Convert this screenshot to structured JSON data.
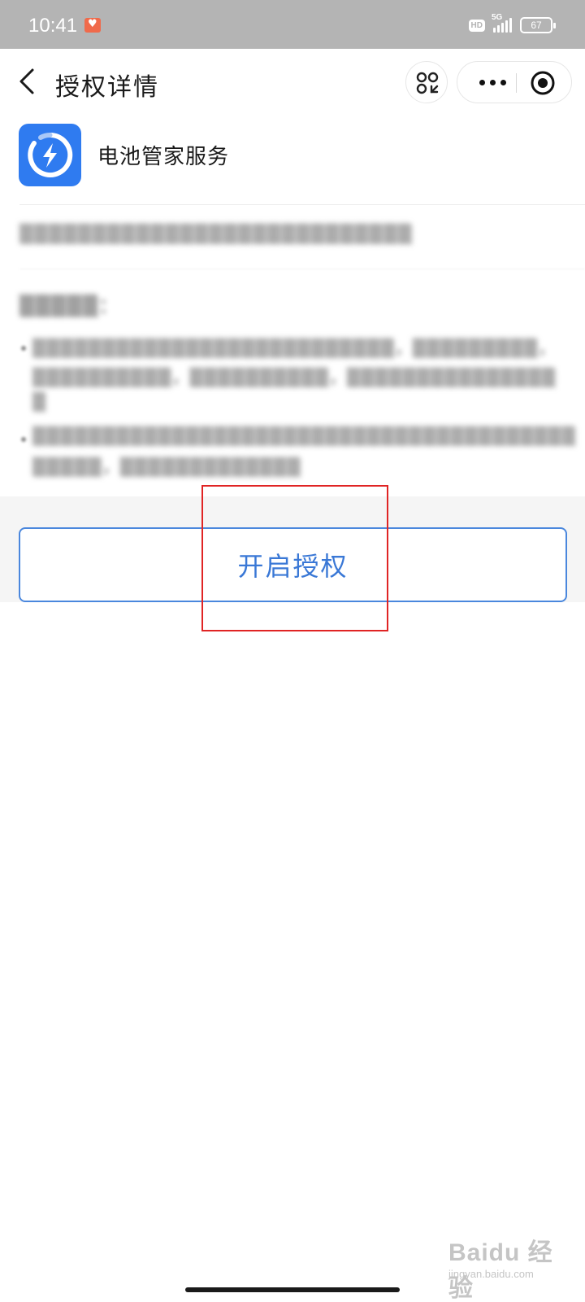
{
  "status_bar": {
    "time": "10:41",
    "hd": "HD",
    "network": "5G",
    "battery": "67"
  },
  "nav": {
    "title": "授权详情"
  },
  "app": {
    "name": "电池管家服务",
    "logo_color": "#2f7bf0"
  },
  "blurred": {
    "subtitle": "▒▒▒▒▒▒▒▒▒▒▒▒▒▒▒▒▒▒▒▒▒▒▒▒▒▒▒",
    "section_heading": "▒▒▒▒▒：",
    "bullet1_line1": "▒▒▒▒▒▒▒▒▒▒▒▒▒▒▒▒▒▒▒▒▒▒▒▒▒▒，▒▒▒▒▒▒▒▒▒，",
    "bullet1_line2": "▒▒▒▒▒▒▒▒▒▒，▒▒▒▒▒▒▒▒▒▒，▒▒▒▒▒▒▒▒▒▒▒▒▒▒▒",
    "bullet1_line3": "▒",
    "bullet2_line1": "▒▒▒▒▒▒▒▒▒▒▒▒▒▒▒▒▒▒▒▒▒▒▒▒▒▒▒▒▒▒▒▒▒▒▒▒▒▒▒",
    "bullet2_line2": "▒▒▒▒▒，▒▒▒▒▒▒▒▒▒▒▒▒▒"
  },
  "actions": {
    "authorize_label": "开启授权"
  },
  "watermark": {
    "main": "Baidu 经验",
    "sub": "jingyan.baidu.com"
  },
  "colors": {
    "accent": "#3a78d6",
    "highlight": "#e02424"
  }
}
